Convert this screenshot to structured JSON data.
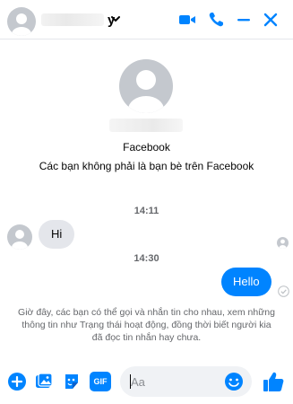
{
  "header": {
    "name_glyph": "y",
    "icons": [
      "avatar",
      "chevron-down-icon",
      "video-call-icon",
      "phone-icon",
      "minimize-icon",
      "close-icon"
    ]
  },
  "profile": {
    "source": "Facebook",
    "note": "Các bạn không phải là bạn bè trên Facebook"
  },
  "messages": [
    {
      "time": "14:11",
      "direction": "incoming",
      "text": "Hi"
    },
    {
      "time": "14:30",
      "direction": "outgoing",
      "text": "Hello"
    }
  ],
  "notice": "Giờ đây, các bạn có thể gọi và nhắn tin cho nhau, xem những thông tin như Trạng thái hoạt động, đồng thời biết người kia đã đọc tin nhắn hay chưa.",
  "composer": {
    "placeholder": "Aa",
    "icons": [
      "add-icon",
      "photo-icon",
      "sticker-icon",
      "gif-icon",
      "emoji-icon",
      "like-icon"
    ],
    "gif_label": "GIF"
  },
  "colors": {
    "accent": "#0084ff",
    "incoming_bubble": "#e4e6eb",
    "muted_text": "#65676b"
  }
}
